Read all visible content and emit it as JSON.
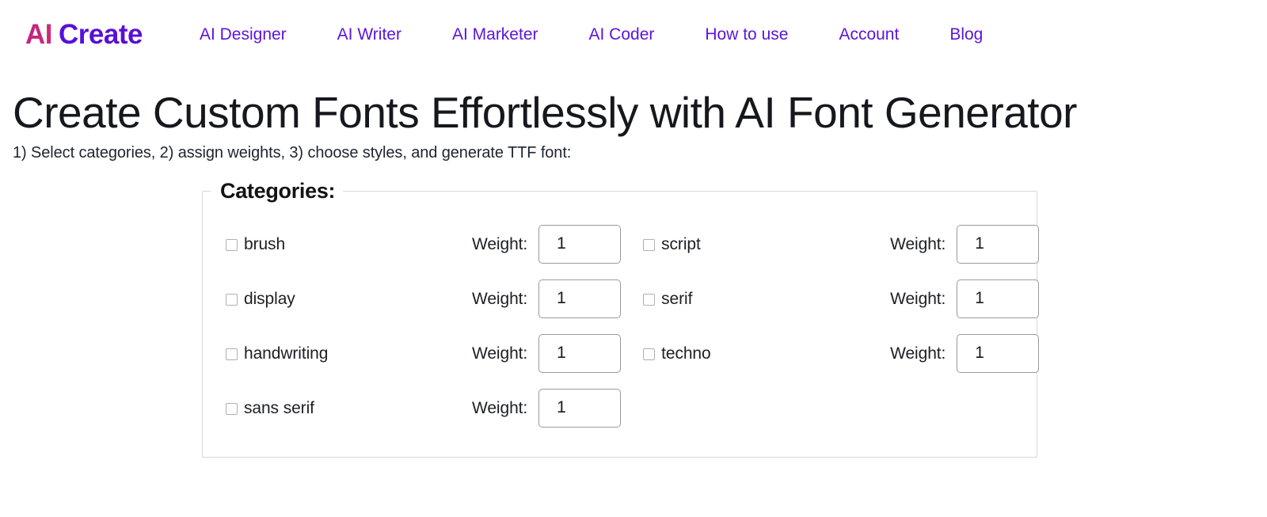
{
  "header": {
    "brand": {
      "part1": "AI",
      "part2": "Create"
    },
    "nav": [
      {
        "label": "AI Designer"
      },
      {
        "label": "AI Writer"
      },
      {
        "label": "AI Marketer"
      },
      {
        "label": "AI Coder"
      },
      {
        "label": "How to use"
      },
      {
        "label": "Account"
      },
      {
        "label": "Blog"
      }
    ]
  },
  "hero": {
    "title": "Create Custom Fonts Effortlessly with AI Font Generator",
    "subtitle": "1) Select categories, 2) assign weights, 3) choose styles, and generate TTF font:"
  },
  "categories": {
    "legend": "Categories:",
    "weight_label": "Weight:",
    "left": [
      {
        "name": "brush",
        "checked": false,
        "weight": "1"
      },
      {
        "name": "display",
        "checked": false,
        "weight": "1"
      },
      {
        "name": "handwriting",
        "checked": false,
        "weight": "1"
      },
      {
        "name": "sans serif",
        "checked": false,
        "weight": "1"
      }
    ],
    "right": [
      {
        "name": "script",
        "checked": false,
        "weight": "1"
      },
      {
        "name": "serif",
        "checked": false,
        "weight": "1"
      },
      {
        "name": "techno",
        "checked": false,
        "weight": "1"
      }
    ]
  },
  "colors": {
    "brand_pink": "#c32286",
    "brand_purple": "#5b0fd6",
    "nav_link": "#5b14dd",
    "text": "#16181d",
    "fieldset_border": "#d8d8d8",
    "input_border": "#9a9a9a",
    "background": "#ffffff"
  }
}
